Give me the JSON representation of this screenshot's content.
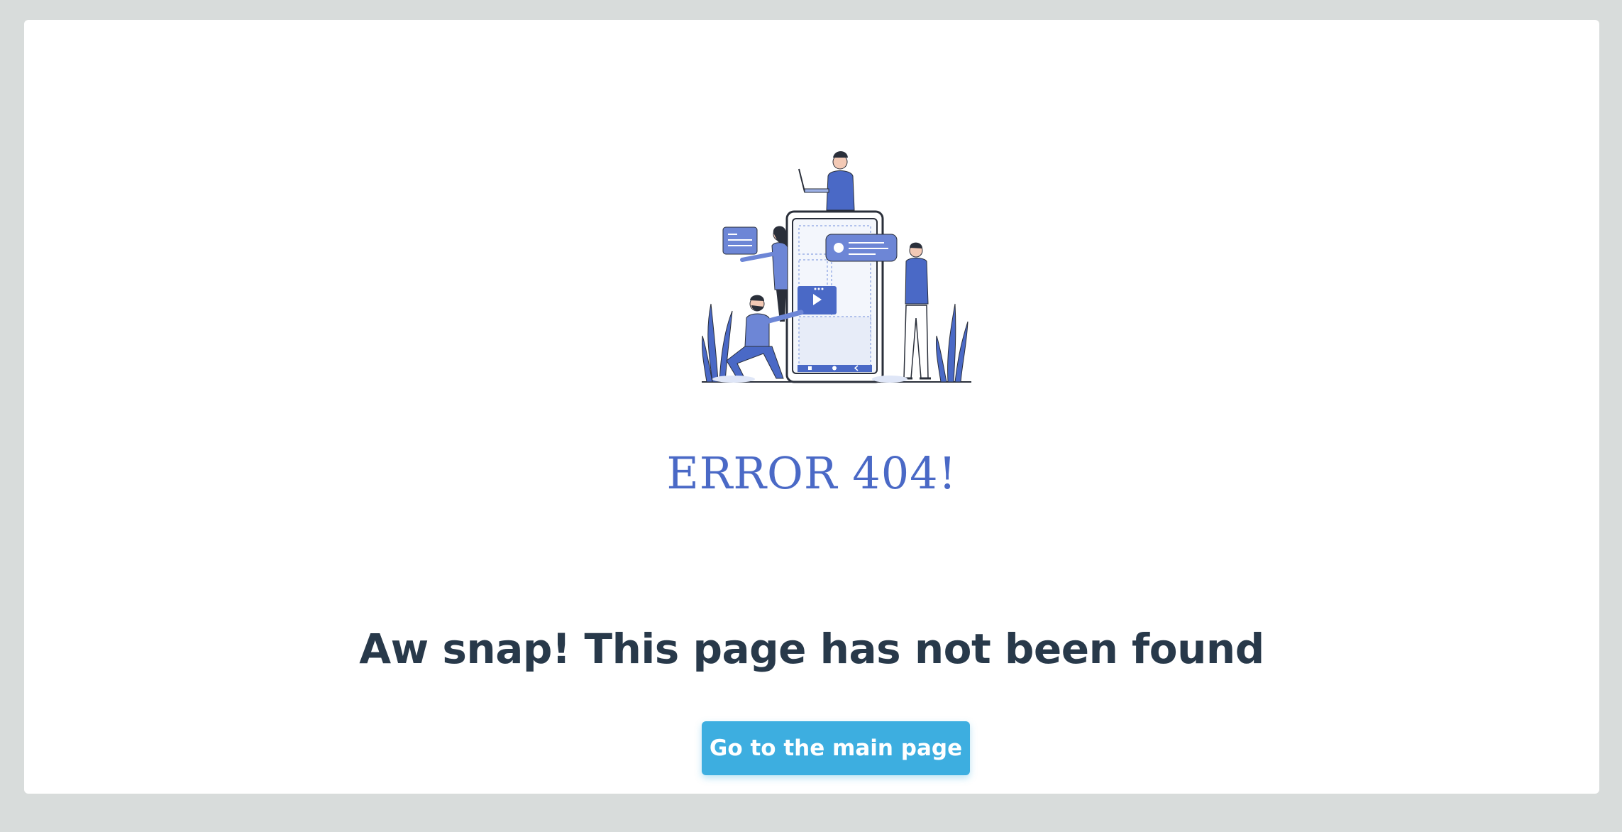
{
  "page": {
    "error_code": "ERROR 404!",
    "headline": "Aw snap! This page has not been found",
    "cta_label": "Go to the main page"
  },
  "illustration": {
    "icon": "team-building-app-illustration"
  },
  "colors": {
    "background": "#d8dcdb",
    "card": "#ffffff",
    "accent_blue": "#4a69c6",
    "button": "#3daee0",
    "headline": "#28394a"
  }
}
